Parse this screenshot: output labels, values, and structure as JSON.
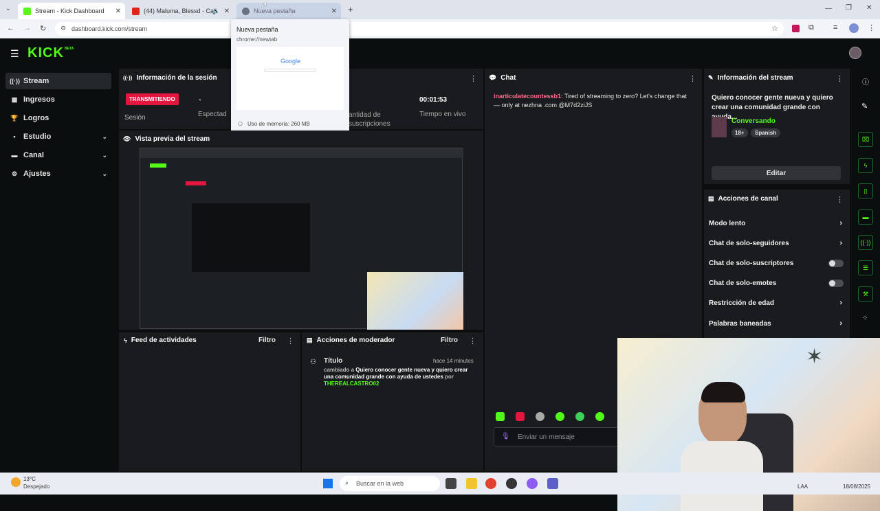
{
  "browser": {
    "tabs": [
      {
        "label": "Stream - Kick Dashboard"
      },
      {
        "label": "(44) Maluma, Blessd - Cali"
      },
      {
        "label": "Nueva pestaña"
      }
    ],
    "url": "dashboard.kick.com/stream",
    "tooltip": {
      "title": "Nueva pestaña",
      "url": "chrome://newtab",
      "google": "Google",
      "memory": "Uso de memoria: 260 MB"
    }
  },
  "header": {
    "logo": "KICK",
    "beta": "BETA"
  },
  "sidebar": {
    "items": [
      {
        "label": "Stream",
        "icon": "broadcast-icon"
      },
      {
        "label": "Ingresos",
        "icon": "income-icon"
      },
      {
        "label": "Logros",
        "icon": "trophy-icon"
      },
      {
        "label": "Estudio",
        "icon": "studio-icon"
      },
      {
        "label": "Canal",
        "icon": "channel-icon"
      },
      {
        "label": "Ajustes",
        "icon": "gear-icon"
      }
    ]
  },
  "session": {
    "title": "Información de la sesión",
    "status": "TRANSMITIENDO",
    "session_label": "Sesión",
    "viewers_value": "-",
    "viewers_label": "Espectad",
    "subs_label": "antidad de suscripciones",
    "time_value": "00:01:53",
    "time_label": "Tiempo en vivo"
  },
  "preview": {
    "title": "Vista previa del stream"
  },
  "chat": {
    "title": "Chat",
    "messages": [
      {
        "user": "inarticulatecountessb1",
        "text": ": Tired of streaming to zero? Let's change that — only at nezhna .com @M7d2ziJS"
      }
    ],
    "input_placeholder": "Enviar un mensaje"
  },
  "stream_info": {
    "title": "Información del stream",
    "stream_title": "Quiero conocer gente nueva y quiero crear una comunidad grande con ayuda...",
    "category": "Conversando",
    "tags": [
      "18+",
      "Spanish"
    ],
    "edit_label": "Editar"
  },
  "channel_actions": {
    "title": "Acciones de canal",
    "items": [
      {
        "label": "Modo lento",
        "control": "chevron"
      },
      {
        "label": "Chat de solo-seguidores",
        "control": "chevron"
      },
      {
        "label": "Chat de solo-suscriptores",
        "control": "toggle"
      },
      {
        "label": "Chat de solo-emotes",
        "control": "toggle"
      },
      {
        "label": "Restricción de edad",
        "control": "chevron"
      },
      {
        "label": "Palabras baneadas",
        "control": "chevron"
      }
    ]
  },
  "activity": {
    "title": "Feed de actividades",
    "filter": "Filtro"
  },
  "mod_actions": {
    "title": "Acciones de moderador",
    "filter": "Filtro",
    "entry": {
      "label": "Título",
      "time": "hace 14 minutos",
      "changed_to": "cambiado a",
      "new_title": "Quiero conocer gente nueva y quiero crear una comunidad grande con ayuda de ustedes",
      "by": "por",
      "user": "THEREALCASTRO02"
    }
  },
  "taskbar": {
    "weather_temp": "13°C",
    "weather_desc": "Despejado",
    "search_placeholder": "Buscar en la web",
    "lang": "LAA",
    "date": "18/08/2025"
  },
  "colors": {
    "accent": "#53fc18",
    "live": "#e2163f",
    "panel": "#191b1f"
  }
}
